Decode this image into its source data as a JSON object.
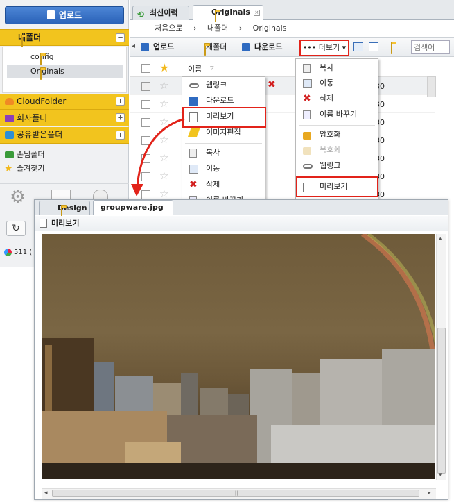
{
  "sidebar": {
    "upload_label": "업로드",
    "my_folder": "내폴더",
    "tree": [
      {
        "label": "config"
      },
      {
        "label": "Originals"
      }
    ],
    "sections": [
      {
        "label": "CloudFolder"
      },
      {
        "label": "회사폴더"
      },
      {
        "label": "공유받은폴더"
      }
    ],
    "guest_folder": "손님폴더",
    "favorites": "즐겨찾기",
    "storage_text": "511 (",
    "collapse_glyph": "−",
    "expand_glyph": "+"
  },
  "top_tabs": [
    {
      "label": "최신이력"
    },
    {
      "label": "Originals",
      "close": "×"
    }
  ],
  "breadcrumb": {
    "items": [
      "처음으로",
      "내폴더",
      "Originals"
    ],
    "sep": "›"
  },
  "toolbar": {
    "upload": "업로드",
    "new_folder": "새폴더",
    "download": "다운로드",
    "more": "••• 더보기",
    "caret": "▾",
    "search_placeholder": "검색어"
  },
  "file_list": {
    "header_name": "이름",
    "sort_glyph": "▿",
    "size_fragment": "30",
    "row_count": 8
  },
  "context_menu_left": {
    "items": [
      "웹링크",
      "다운로드",
      "미리보기",
      "이미지편집",
      "복사",
      "이동",
      "삭제",
      "이름 바꾸기"
    ]
  },
  "context_menu_right": {
    "items": [
      "복사",
      "이동",
      "삭제",
      "이름 바꾸기",
      "암호화",
      "복호화",
      "웹링크",
      "미리보기"
    ]
  },
  "preview_window": {
    "tabs": [
      {
        "label": "Design"
      },
      {
        "label": "groupware.jpg",
        "close": "×"
      }
    ],
    "title": "미리보기",
    "scroll_up": "▴",
    "scroll_down": "▾",
    "scroll_left": "◂",
    "scroll_right": "▸",
    "grip": "|||"
  },
  "colors": {
    "sidebar_yellow": "#f2c41e",
    "highlight_red": "#e2231a",
    "upload_blue": "#2f6bc1"
  }
}
